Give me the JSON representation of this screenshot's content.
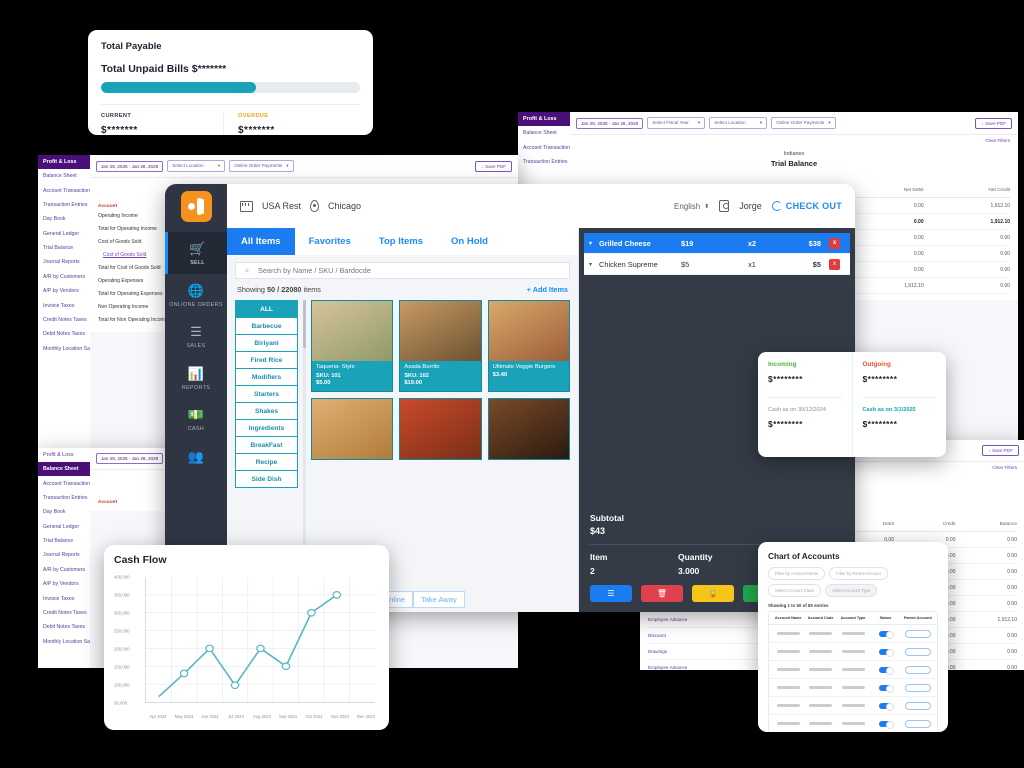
{
  "payable": {
    "title": "Total Payable",
    "subtitle": "Total Unpaid Bills $*******",
    "progress_pct": 60,
    "current_label": "CURRENT",
    "current_value": "$*******",
    "overdue_label": "OVERDUE",
    "overdue_value": "$*******"
  },
  "report_nav": {
    "header": "Profit & Loss",
    "items": [
      "Balance Sheet",
      "Account Transactions",
      "Transaction Entries",
      "Day Book",
      "General Ledger",
      "Trial Balance",
      "Journal Reports",
      "A/R by Customers",
      "A/P by Vendors",
      "Invoice Taxes",
      "Credit Notes Taxes",
      "Debit Notes Taxes",
      "Monthly Location Sales"
    ]
  },
  "report_filters": {
    "date_range": "Jan 28, 2025 - Jan 28, 2025",
    "fiscal_year": "Select Fiscal Year",
    "location": "Select Location",
    "payments": "Online Order Payments",
    "save_pdf": "Save PDF",
    "clear_filters": "Clear Filters"
  },
  "trial_balance": {
    "company": "Indianes",
    "title": "Trial Balance",
    "columns": [
      "Net Debit",
      "Net Credit"
    ],
    "rows": [
      [
        "0.00",
        "1,912.10"
      ],
      [
        "0.00",
        "1,912.10"
      ],
      [
        "0.00",
        "0.00"
      ],
      [
        "0.00",
        "0.00"
      ],
      [
        "0.00",
        "0.00"
      ],
      [
        "1,912.10",
        "0.00"
      ]
    ]
  },
  "pnl": {
    "account_header": "Account",
    "rows": [
      {
        "label": "Operating Income",
        "link": false
      },
      {
        "label": "Total for Operating Income",
        "link": false
      },
      {
        "label": "Cost of Goods Sold",
        "link": false
      },
      {
        "label": "Cost of Goods Sold",
        "link": true
      },
      {
        "label": "Total for Cost of Goods Sold",
        "link": false
      },
      {
        "label": "Operating Expenses",
        "link": false
      },
      {
        "label": "Total for Operating Expenses",
        "link": false
      },
      {
        "label": "Non Operating Income",
        "link": false
      },
      {
        "label": "Total for Non Operating Income",
        "link": false
      }
    ]
  },
  "right_report": {
    "columns": [
      "Debit",
      "Credit",
      "Balance"
    ],
    "accounts": [
      "Discount",
      "Drawings",
      "Employee Advance"
    ],
    "values": [
      "0.00",
      "0.00",
      "0.00",
      "0.00",
      "0.00",
      "1,912.10",
      "0.00",
      "0.00",
      "0.00"
    ]
  },
  "pos": {
    "store": "USA Rest",
    "location": "Chicago",
    "language": "English",
    "user": "Jorge",
    "checkout": "CHECK OUT",
    "nav": [
      {
        "label": "SELL",
        "icon": "cart-icon",
        "active": true
      },
      {
        "label": "ONLIONE ORDERS",
        "icon": "globe-icon",
        "active": false
      },
      {
        "label": "SALES",
        "icon": "list-icon",
        "active": false
      },
      {
        "label": "REPORTS",
        "icon": "bar-chart-icon",
        "active": false
      },
      {
        "label": "CASH",
        "icon": "banknote-icon",
        "active": false
      },
      {
        "label": "",
        "icon": "people-icon",
        "active": false
      }
    ],
    "tabs": [
      {
        "label": "All Items",
        "active": true
      },
      {
        "label": "Favorites",
        "active": false
      },
      {
        "label": "Top Items",
        "active": false
      },
      {
        "label": "On Hold",
        "active": false
      }
    ],
    "search_placeholder": "Search by Name / SKU / Bardocde",
    "showing_prefix": "Showing",
    "showing_count": "50 / 22080",
    "showing_suffix": "items",
    "add_items": "+ Add Items",
    "categories": [
      {
        "label": "ALL",
        "active": true
      },
      {
        "label": "Barbecue",
        "active": false
      },
      {
        "label": "Biriyani",
        "active": false
      },
      {
        "label": "Fired Rice",
        "active": false
      },
      {
        "label": "Modifiers",
        "active": false
      },
      {
        "label": "Starters",
        "active": false
      },
      {
        "label": "Shakes",
        "active": false
      },
      {
        "label": "Ingredients",
        "active": false
      },
      {
        "label": "BreakFast",
        "active": false
      },
      {
        "label": "Recipe",
        "active": false
      },
      {
        "label": "Side Dish",
        "active": false
      }
    ],
    "items": [
      {
        "name": "Taqueria- Style",
        "sku": "SKU: 101",
        "price": "$5.00",
        "c1": "#d8c49a",
        "c2": "#8f9a6a"
      },
      {
        "name": "Asada Burrito",
        "sku": "SKU: 102",
        "price": "$19.00",
        "c1": "#c99a64",
        "c2": "#6c5132"
      },
      {
        "name": "Ultimate Veggie Burgers",
        "sku": "",
        "price": "$3.40",
        "c1": "#d9a96a",
        "c2": "#9c5d3a"
      },
      {
        "name": "",
        "sku": "",
        "price": "",
        "c1": "#e0b072",
        "c2": "#b07c3c"
      },
      {
        "name": "",
        "sku": "",
        "price": "",
        "c1": "#c94a2a",
        "c2": "#7a2e18"
      },
      {
        "name": "",
        "sku": "",
        "price": "",
        "c1": "#7a4a28",
        "c2": "#2b1a10"
      }
    ],
    "modes": [
      "Pos Store Online",
      "Take Away"
    ],
    "cart": [
      {
        "name": "Grilled Cheese",
        "price": "$19",
        "qty": "x2",
        "total": "$38",
        "remove": "x",
        "active": true
      },
      {
        "name": "Chicken Supreme",
        "price": "$5",
        "qty": "x1",
        "total": "$5",
        "remove": "x",
        "active": false
      }
    ],
    "subtotal_label": "Subtotal",
    "subtotal_value": "$43",
    "item_label": "Item",
    "item_value": "2",
    "qty_label": "Quantity",
    "qty_value": "3.000",
    "actions": [
      {
        "name": "menu-button",
        "icon": "☰",
        "color": "#1a7cf0"
      },
      {
        "name": "delete-button",
        "icon": "🗑",
        "color": "#e0414f"
      },
      {
        "name": "hold-button",
        "icon": "🔒",
        "color": "#f5c518"
      },
      {
        "name": "pay-button",
        "icon": "",
        "color": "#22a84f"
      }
    ]
  },
  "cash_flow": {
    "title": "Cash Flow"
  },
  "chart_data": {
    "type": "line",
    "title": "Cash Flow",
    "xlabel": "",
    "ylabel": "",
    "x": [
      "Apr 2024",
      "May 2024",
      "Jun 2024",
      "Jul 2024",
      "Aug 2024",
      "Sep 2024",
      "Oct 2024",
      "Nov 2024",
      "Dec 2024"
    ],
    "series": [
      {
        "name": "Cash Flow",
        "values": [
          65000,
          130000,
          200000,
          97000,
          200000,
          150000,
          300000,
          350000,
          null
        ],
        "color": "#56b8c2"
      }
    ],
    "ytick_labels": [
      "400,000",
      "350,000",
      "300,000",
      "250,000",
      "200,000",
      "150,000",
      "100,000",
      "50,000"
    ],
    "ylim": [
      50000,
      400000
    ],
    "grid": true,
    "legend": "none",
    "markers": true
  },
  "in_out": {
    "incoming_label": "Incoming",
    "incoming_value": "$********",
    "outgoing_label": "Outgoing",
    "outgoing_value": "$********",
    "incoming_date": "Cash as on 30/12/2024",
    "incoming_date_value": "$********",
    "outgoing_date": "Cash as on 3/1/2025",
    "outgoing_date_value": "$********"
  },
  "coa": {
    "title": "Chart of Accounts",
    "filters": [
      "Filter by Account Name",
      "Filter by Parent Account",
      "Select Account Class",
      "Select Account Type"
    ],
    "showing": "Showing 1 to 50 of 80 entries",
    "columns": [
      "Account Name",
      "Account Code",
      "Account Type",
      "Status",
      "Parent Account"
    ],
    "row_count": 6
  }
}
